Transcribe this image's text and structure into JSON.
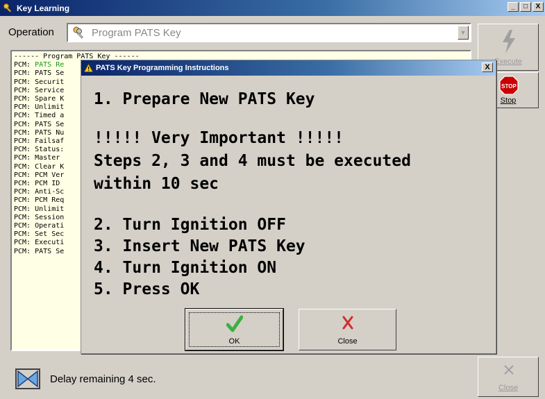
{
  "window": {
    "title": "Key Learning",
    "controls": [
      "_",
      "□",
      "X"
    ]
  },
  "operation": {
    "label": "Operation",
    "selected": "Program PATS Key"
  },
  "log": {
    "header": "------ Program PATS Key ------",
    "lines": [
      {
        "prefix": "PCM: ",
        "text": "PATS Re",
        "color": "green"
      },
      {
        "prefix": "PCM: ",
        "text": "PATS Se"
      },
      {
        "prefix": "PCM: ",
        "text": "Securit"
      },
      {
        "prefix": "PCM: ",
        "text": "Service"
      },
      {
        "prefix": "PCM: ",
        "text": "Spare K"
      },
      {
        "prefix": "PCM: ",
        "text": "Unlimit"
      },
      {
        "prefix": "PCM: ",
        "text": "Timed a"
      },
      {
        "prefix": "PCM: ",
        "text": "PATS Se"
      },
      {
        "prefix": "PCM: ",
        "text": "PATS Nu"
      },
      {
        "prefix": "PCM: ",
        "text": "Failsaf"
      },
      {
        "prefix": "PCM: ",
        "text": "Status:"
      },
      {
        "prefix": "PCM: ",
        "text": "Master "
      },
      {
        "prefix": "PCM: ",
        "text": "Clear K"
      },
      {
        "prefix": "PCM: ",
        "text": "PCM Ver"
      },
      {
        "prefix": "PCM: ",
        "text": "PCM ID "
      },
      {
        "prefix": "PCM: ",
        "text": "Anti-Sc"
      },
      {
        "prefix": "PCM: ",
        "text": "PCM Req"
      },
      {
        "prefix": "PCM: ",
        "text": "Unlimit"
      },
      {
        "prefix": "PCM: ",
        "text": "Session"
      },
      {
        "prefix": "PCM: ",
        "text": "Operati"
      },
      {
        "prefix": "PCM: ",
        "text": "Set Sec"
      },
      {
        "prefix": "PCM: ",
        "text": "Executi"
      },
      {
        "prefix": "PCM: ",
        "text": "PATS Se"
      }
    ]
  },
  "sidebar": {
    "execute_label": "Execute",
    "stop_label": "Stop",
    "stop_sign": "STOP",
    "close_label": "Close"
  },
  "status": {
    "text": "Delay remaining 4 sec."
  },
  "dialog": {
    "title": "PATS Key Programming Instructions",
    "close_glyph": "X",
    "lines": [
      "1. Prepare New PATS Key",
      "!!!!! Very Important !!!!!",
      "Steps 2, 3 and 4 must be executed",
      "within 10 sec",
      "2. Turn Ignition OFF",
      "3. Insert New PATS Key",
      "4. Turn Ignition ON",
      "5. Press OK"
    ],
    "ok_label": "OK",
    "cancel_label": "Close"
  },
  "colors": {
    "titlebar": "#0a246a",
    "window_bg": "#d4d0c8",
    "log_bg": "#ffffe6",
    "log_highlight": "#129912",
    "ok_check": "#3cb043",
    "cancel_x": "#d22c2c",
    "stop_sign": "#cc0000"
  },
  "icons": {
    "app": "keys-icon",
    "operation": "keys-icon",
    "execute": "lightning-icon",
    "stop": "stop-sign-icon",
    "status": "bowtie-icon",
    "close": "x-icon",
    "warning": "warning-icon",
    "ok": "checkmark-icon",
    "cancel": "red-x-icon"
  }
}
